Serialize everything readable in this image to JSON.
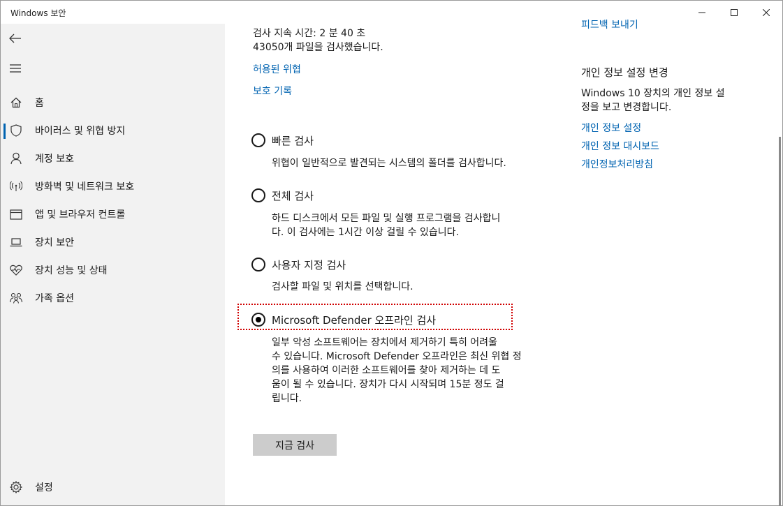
{
  "window": {
    "title": "Windows 보안"
  },
  "sidebar": {
    "items": [
      {
        "label": "홈",
        "icon": "home-icon"
      },
      {
        "label": "바이러스 및 위협 방지",
        "icon": "shield-icon",
        "active": true
      },
      {
        "label": "계정 보호",
        "icon": "person-icon"
      },
      {
        "label": "방화벽 및 네트워크 보호",
        "icon": "wireless-icon"
      },
      {
        "label": "앱 및 브라우저 컨트롤",
        "icon": "browser-window-icon"
      },
      {
        "label": "장치 보안",
        "icon": "laptop-icon"
      },
      {
        "label": "장치 성능 및 상태",
        "icon": "heart-pulse-icon"
      },
      {
        "label": "가족 옵션",
        "icon": "family-icon"
      }
    ],
    "settings_label": "설정"
  },
  "main": {
    "scan_duration": "검사 지속 시간: 2 분 40 초",
    "files_scanned": "43050개 파일을 검사했습니다.",
    "links": {
      "allowed_threats": "허용된 위협",
      "protection_history": "보호 기록"
    },
    "options": [
      {
        "label": "빠른 검사",
        "description": "위협이 일반적으로 발견되는 시스템의 폴더를 검사합니다.",
        "selected": false
      },
      {
        "label": "전체 검사",
        "description_line1": "하드 디스크에서 모든 파일 및 실행 프로그램을 검사합니",
        "description_line2": "다. 이 검사에는 1시간 이상 걸릴 수 있습니다.",
        "selected": false
      },
      {
        "label": "사용자 지정 검사",
        "description": "검사할 파일 및 위치를 선택합니다.",
        "selected": false
      },
      {
        "label": "Microsoft Defender 오프라인 검사",
        "description_lines": [
          "일부 악성 소프트웨어는 장치에서 제거하기 특히 어려울",
          "수 있습니다. Microsoft Defender 오프라인은 최신 위협 정",
          "의를 사용하여 이러한 소프트웨어를 찾아 제거하는 데 도",
          "움이 될 수 있습니다. 장치가 다시 시작되며 15분 정도 걸",
          "립니다."
        ],
        "selected": true
      }
    ],
    "scan_now_label": "지금 검사"
  },
  "right": {
    "feedback_link": "피드백 보내기",
    "privacy_heading": "개인 정보 설정 변경",
    "privacy_desc_line1": "Windows 10 장치의 개인 정보 설",
    "privacy_desc_line2": "정을 보고 변경합니다.",
    "links": [
      "개인 정보 설정",
      "개인 정보 대시보드",
      "개인정보처리방침"
    ]
  },
  "colors": {
    "accent": "#0063b1",
    "sidebar_bg": "#f2f2f2",
    "button_bg": "#cccccc",
    "highlight": "#d00000"
  }
}
